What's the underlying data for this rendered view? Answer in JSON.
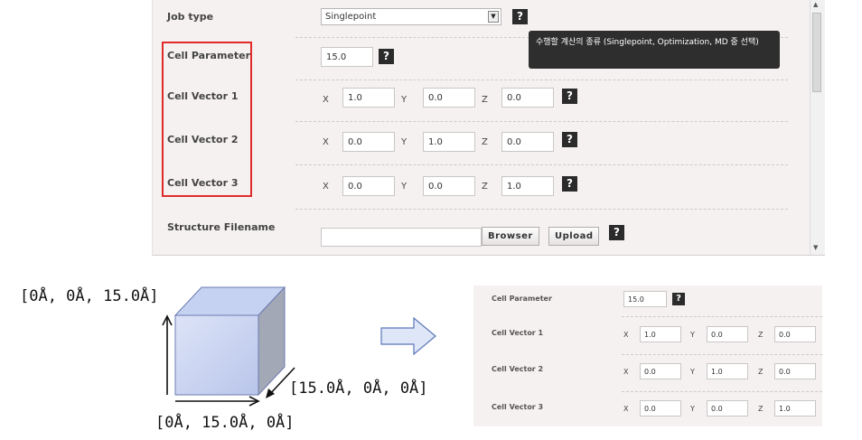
{
  "form": {
    "job_type": {
      "label": "Job type",
      "value": "Singlepoint"
    },
    "cell_parameter": {
      "label": "Cell Parameter",
      "value": "15.0"
    },
    "cell_vector_1": {
      "label": "Cell Vector 1",
      "x": "1.0",
      "y": "0.0",
      "z": "0.0"
    },
    "cell_vector_2": {
      "label": "Cell Vector 2",
      "x": "0.0",
      "y": "1.0",
      "z": "0.0"
    },
    "cell_vector_3": {
      "label": "Cell Vector 3",
      "x": "0.0",
      "y": "0.0",
      "z": "1.0"
    },
    "structure_filename": {
      "label": "Structure Filename",
      "value": ""
    },
    "axis": {
      "x": "X",
      "y": "Y",
      "z": "Z"
    },
    "help_glyph": "?",
    "tooltip": "수행할 계산의 종류 (Singlepoint, Optimization, MD 중 선택)",
    "browse_label": "Browser",
    "upload_label": "Upload"
  },
  "cube": {
    "top_label": "[0Å, 0Å, 15.0Å]",
    "right_label": "[15.0Å, 0Å, 0Å]",
    "bottom_label": "[0Å, 15.0Å, 0Å]"
  },
  "colors": {
    "highlight": "#e02a2a",
    "cube_fill": "#c9d3ef",
    "arrow_fill": "#dfe6f7"
  },
  "icons": [
    "dropdown-arrow-icon",
    "help-icon",
    "scroll-up-icon",
    "scroll-down-icon",
    "right-arrow-icon",
    "cube-illustration"
  ]
}
